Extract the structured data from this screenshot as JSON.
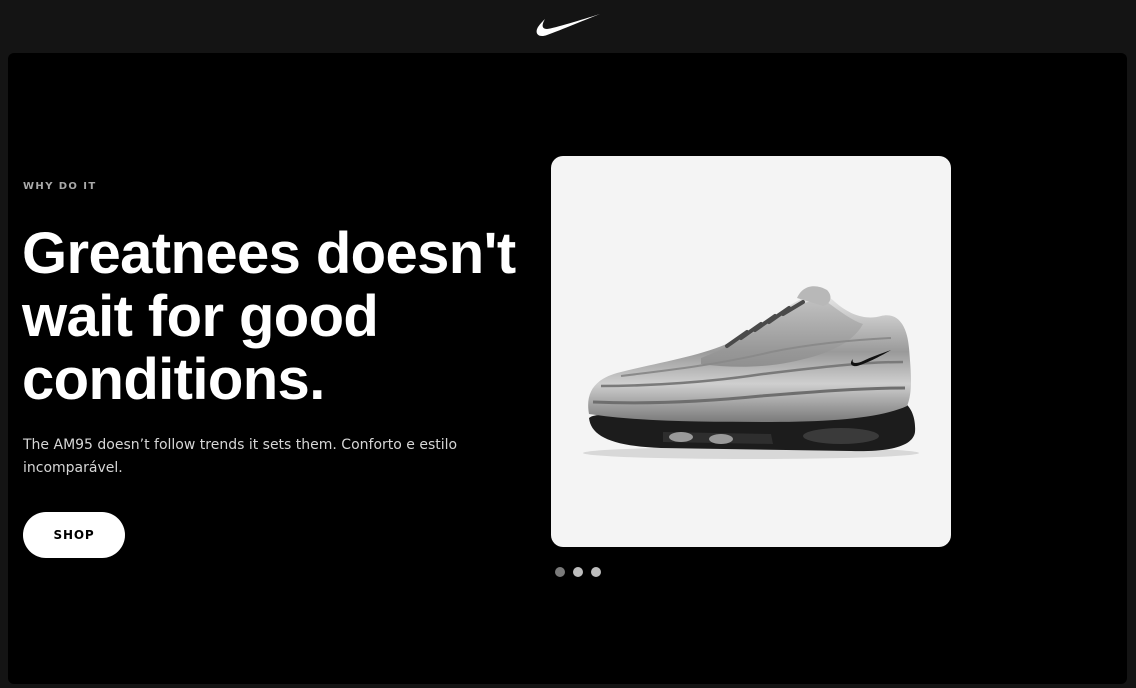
{
  "header": {
    "logo": "nike-swoosh-logo"
  },
  "hero": {
    "eyebrow": "WHY DO IT",
    "headline": [
      "Greatnees doesn't",
      "wait for good",
      "conditions."
    ],
    "description": "The AM95 doesn’t follow trends it sets them. Conforto e estilo incomparável.",
    "cta_label": "SHOP"
  },
  "product": {
    "image": "silver-air-max-95-sneaker",
    "carousel": {
      "slide_count": 3,
      "active_index": 0
    }
  },
  "colors": {
    "background": "#000000",
    "topbar": "#141414",
    "card": "#f4f4f4",
    "text": "#ffffff",
    "eyebrow": "#a9a9a9"
  }
}
